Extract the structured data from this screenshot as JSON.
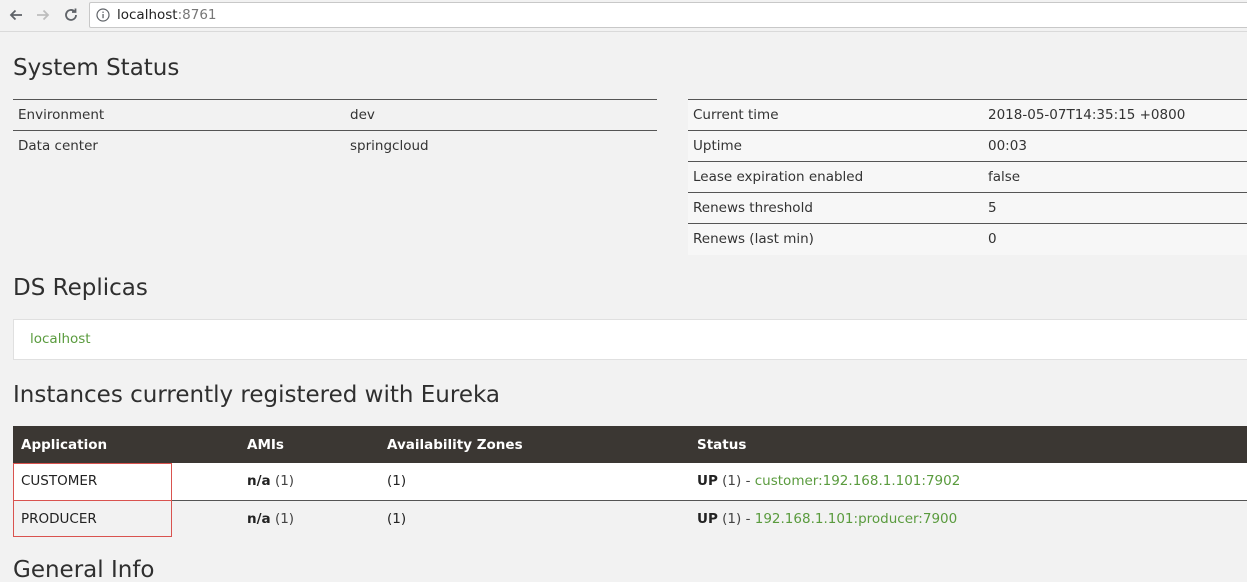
{
  "browser": {
    "url_host": "localhost",
    "url_port": ":8761"
  },
  "system_status": {
    "heading": "System Status",
    "left": [
      {
        "key": "Environment",
        "value": "dev"
      },
      {
        "key": "Data center",
        "value": "springcloud"
      }
    ],
    "right": [
      {
        "key": "Current time",
        "value": "2018-05-07T14:35:15 +0800"
      },
      {
        "key": "Uptime",
        "value": "00:03"
      },
      {
        "key": "Lease expiration enabled",
        "value": "false"
      },
      {
        "key": "Renews threshold",
        "value": "5"
      },
      {
        "key": "Renews (last min)",
        "value": "0"
      }
    ]
  },
  "replicas": {
    "heading": "DS Replicas",
    "items": [
      "localhost"
    ]
  },
  "instances": {
    "heading": "Instances currently registered with Eureka",
    "columns": [
      "Application",
      "AMIs",
      "Availability Zones",
      "Status"
    ],
    "rows": [
      {
        "application": "CUSTOMER",
        "ami": "n/a",
        "ami_count": "(1)",
        "zones": "(1)",
        "status": "UP",
        "status_count": "(1) -",
        "instance": "customer:192.168.1.101:7902"
      },
      {
        "application": "PRODUCER",
        "ami": "n/a",
        "ami_count": "(1)",
        "zones": "(1)",
        "status": "UP",
        "status_count": "(1) -",
        "instance": "192.168.1.101:producer:7900"
      }
    ]
  },
  "general_info": {
    "heading": "General Info"
  }
}
